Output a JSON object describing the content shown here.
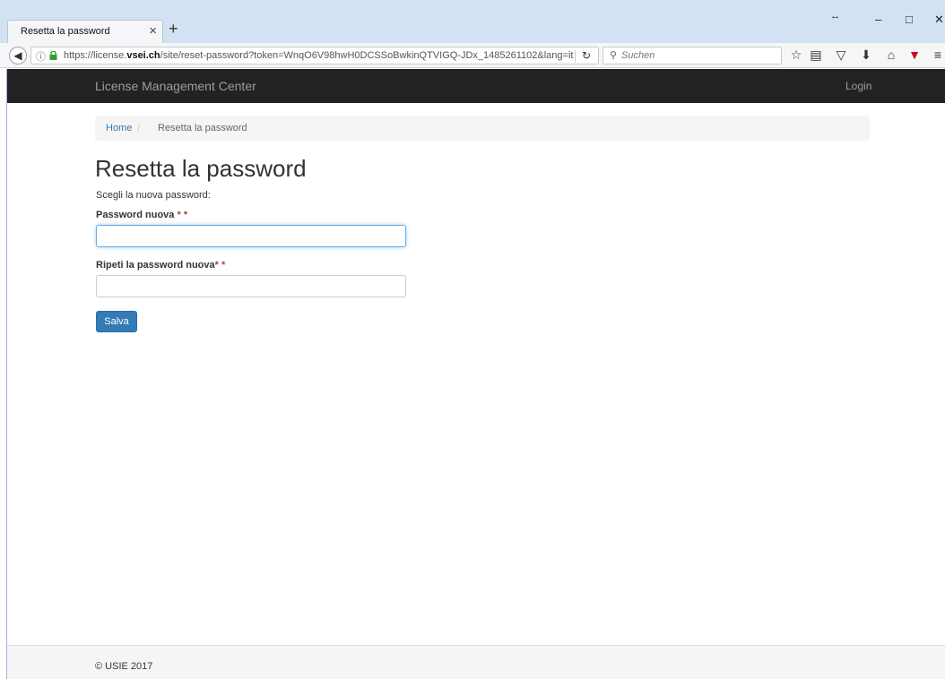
{
  "browser": {
    "tab_title": "Resetta la password",
    "url_prefix": "https://license.",
    "url_domain": "vsei.ch",
    "url_path": "/site/reset-password?token=WnqO6V98hwH0DCSSoBwkinQTVIGQ-JDx_1485261102&lang=it",
    "search_placeholder": "Suchen"
  },
  "site": {
    "brand": "License Management Center",
    "login": "Login"
  },
  "breadcrumb": {
    "home": "Home",
    "separator": "/",
    "current": "Resetta la password"
  },
  "form": {
    "title": "Resetta la password",
    "intro": "Scegli la nuova password:",
    "field1_label": "Password nuova",
    "field1_marker": " * *",
    "field2_label": "Ripeti la password nuova",
    "field2_marker": "* *",
    "submit": "Salva"
  },
  "footer": {
    "copyright": "© USIE 2017"
  },
  "colors": {
    "navbar": "#222222",
    "link": "#337ab7",
    "button": "#337ab7",
    "required": "#a94442"
  }
}
